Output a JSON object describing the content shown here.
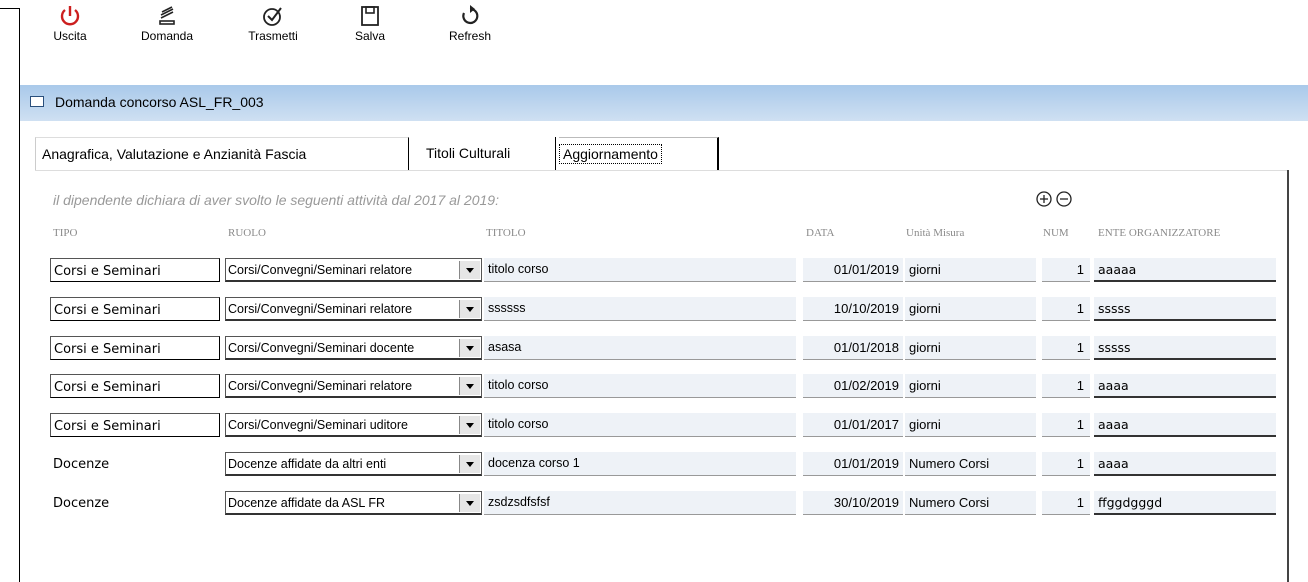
{
  "toolbar": {
    "buttons": [
      {
        "label": "Uscita",
        "icon": "power-icon"
      },
      {
        "label": "Domanda",
        "icon": "stack-icon"
      },
      {
        "label": "Trasmetti",
        "icon": "check-circle-icon"
      },
      {
        "label": "Salva",
        "icon": "floppy-icon"
      },
      {
        "label": "Refresh",
        "icon": "refresh-icon"
      }
    ]
  },
  "panel": {
    "title": "Domanda concorso ASL_FR_003",
    "header_color": "#b9d4ef"
  },
  "tabs": [
    {
      "label": "Anagrafica, Valutazione e Anzianità Fascia",
      "active": false
    },
    {
      "label": "Titoli Culturali",
      "active": false
    },
    {
      "label": "Aggiornamento",
      "active": true
    }
  ],
  "intro": "il dipendente dichiara di aver svolto le seguenti attività dal 2017 al 2019:",
  "actions": {
    "add_icon": "plus-circle-icon",
    "remove_icon": "minus-circle-icon"
  },
  "columns": {
    "tipo": "TIPO",
    "ruolo": "RUOLO",
    "titolo": "TITOLO",
    "data": "DATA",
    "unita": "Unità Misura",
    "num": "NUM",
    "ente": "ENTE ORGANIZZATORE"
  },
  "rows": [
    {
      "tipo": "Corsi e Seminari",
      "ruolo": "Corsi/Convegni/Seminari relatore",
      "titolo": "titolo corso",
      "data": "01/01/2019",
      "unita": "giorni",
      "num": "1",
      "ente": "aaaaa"
    },
    {
      "tipo": "Corsi e Seminari",
      "ruolo": "Corsi/Convegni/Seminari relatore",
      "titolo": "ssssss",
      "data": "10/10/2019",
      "unita": "giorni",
      "num": "1",
      "ente": "sssss"
    },
    {
      "tipo": "Corsi e Seminari",
      "ruolo": "Corsi/Convegni/Seminari docente",
      "titolo": "asasa",
      "data": "01/01/2018",
      "unita": "giorni",
      "num": "1",
      "ente": "sssss"
    },
    {
      "tipo": "Corsi e Seminari",
      "ruolo": "Corsi/Convegni/Seminari relatore",
      "titolo": "titolo corso",
      "data": "01/02/2019",
      "unita": "giorni",
      "num": "1",
      "ente": "aaaa"
    },
    {
      "tipo": "Corsi e Seminari",
      "ruolo": "Corsi/Convegni/Seminari uditore",
      "titolo": "titolo corso",
      "data": "01/01/2017",
      "unita": "giorni",
      "num": "1",
      "ente": "aaaa"
    },
    {
      "tipo": "Docenze",
      "ruolo": "Docenze affidate da altri enti",
      "titolo": "docenza corso 1",
      "data": "01/01/2019",
      "unita": "Numero Corsi",
      "num": "1",
      "ente": "aaaa"
    },
    {
      "tipo": "Docenze",
      "ruolo": "Docenze affidate da ASL FR",
      "titolo": "zsdzsdfsfsf",
      "data": "30/10/2019",
      "unita": "Numero Corsi",
      "num": "1",
      "ente": "ffggdgggd"
    }
  ]
}
